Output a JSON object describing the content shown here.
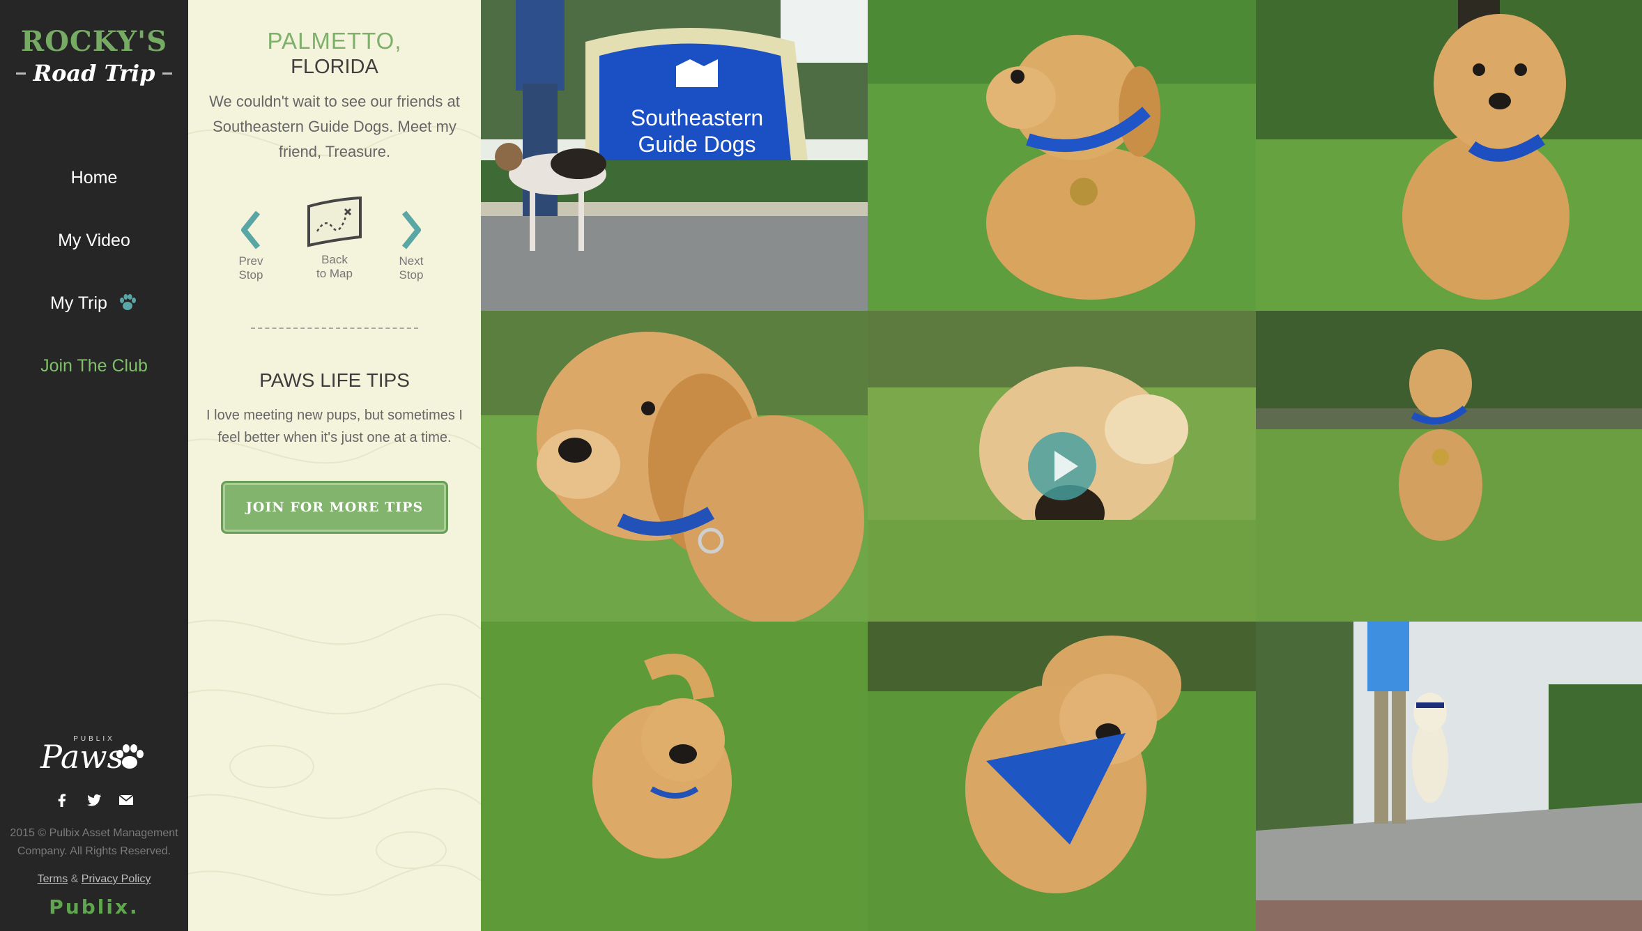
{
  "brand": {
    "line1": "ROCKY'S",
    "line2": "Road Trip"
  },
  "nav": {
    "items": [
      {
        "label": "Home"
      },
      {
        "label": "My Video"
      },
      {
        "label": "My Trip"
      },
      {
        "label": "Join The Club"
      }
    ]
  },
  "footer": {
    "paws_small": "PUBLIX",
    "paws_word": "Paws",
    "social": [
      "facebook-icon",
      "twitter-icon",
      "mail-icon"
    ],
    "copyright": "2015 © Pulbix Asset Management\nCompany. All Rights Reserved.",
    "terms": "Terms",
    "amp": " & ",
    "privacy": "Privacy Policy",
    "publix": "Publix."
  },
  "stop": {
    "city": "PALMETTO,",
    "state": "FLORIDA",
    "description": "We couldn't wait to see our friends at Southeastern Guide Dogs. Meet my friend, Treasure."
  },
  "stop_nav": {
    "prev": "Prev\nStop",
    "map": "Back\nto Map",
    "next": "Next\nStop"
  },
  "tips": {
    "title": "PAWS LIFE TIPS",
    "text": "I love meeting new pups, but sometimes I feel better when it's just one at a time.",
    "cta": "JOIN FOR MORE TIPS"
  },
  "gallery": {
    "sign_line1": "Southeastern",
    "sign_line2": "Guide Dogs",
    "photos": [
      "guide-dogs-sign-with-beagle",
      "puppy-sitting-grass",
      "puppy-walking-grass",
      "puppy-closeup",
      "puppy-video",
      "puppy-sitting-distance",
      "puppy-walking-toward",
      "puppy-blue-bandana",
      "trainer-with-labrador"
    ]
  },
  "colors": {
    "sidebar": "#262626",
    "panel": "#f4f4dd",
    "accent_green": "#7fb06b",
    "arrow_teal": "#5aa6a4"
  }
}
